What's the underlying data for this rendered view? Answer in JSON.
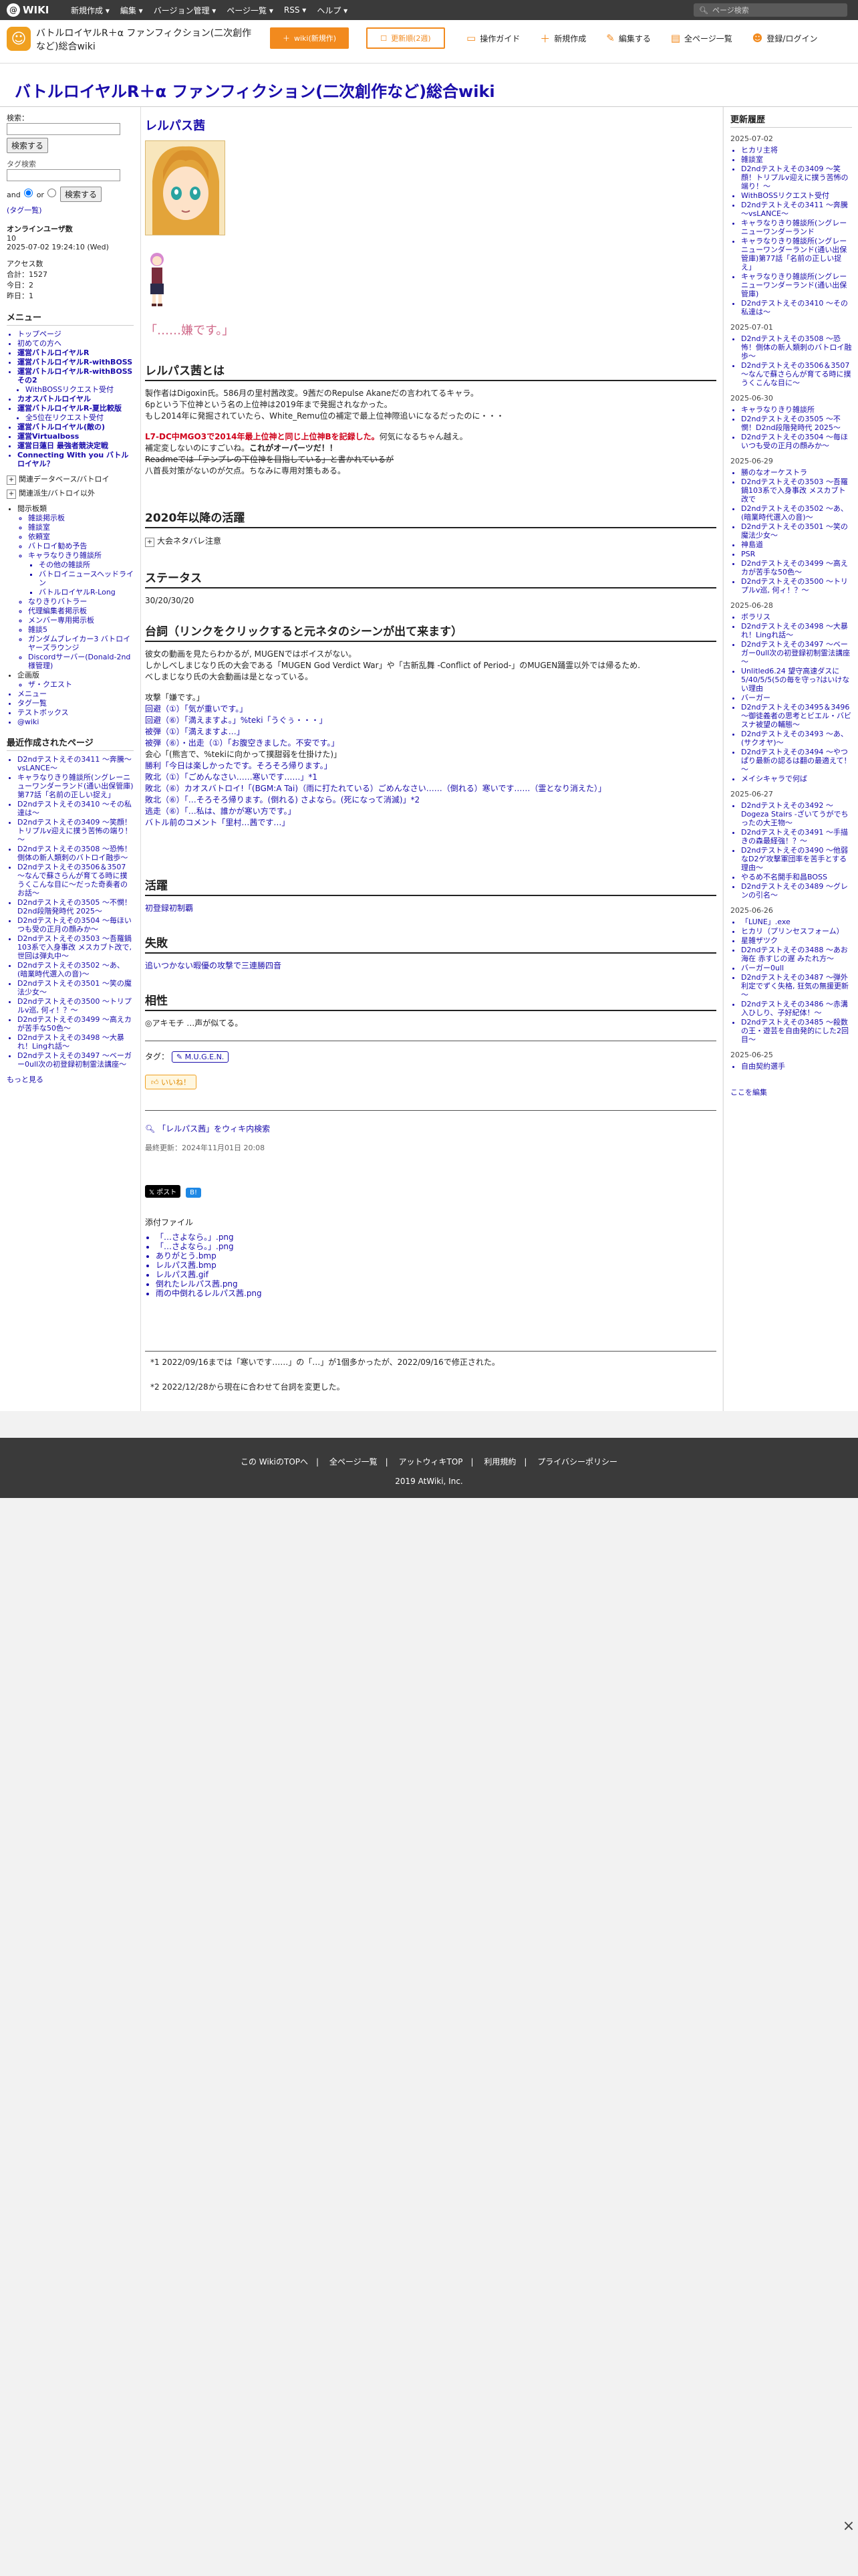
{
  "topbar": {
    "logo": "WIKI",
    "menus": [
      "新規作成 ▾",
      "編集 ▾",
      "バージョン管理 ▾",
      "ページ一覧 ▾",
      "RSS ▾",
      "ヘルプ ▾"
    ],
    "search_placeholder": "ページ検索"
  },
  "header": {
    "wiki_name": "バトルロイヤルR＋α ファンフィクション(二次創作など)総合wiki",
    "btn_wiki": "wiki(新規作)",
    "btn_update": "更新順(2週)",
    "tools": [
      "操作ガイド",
      "新規作成",
      "編集する",
      "全ページ一覧",
      "登録/ログイン"
    ]
  },
  "page_title": "バトルロイヤルR＋α ファンフィクション(二次創作など)総合wiki",
  "left": {
    "search_label": "検索：",
    "search_button": "検索する",
    "tag_label": "タグ検索",
    "and": "and",
    "or": "or",
    "tag_search_button": "検索する",
    "tag_list_link": "(タグ一覧)",
    "online_label": "オンラインユーザ数",
    "online_count": "10",
    "online_date": "2025-07-02 19:24:10 (Wed)",
    "access_label": "アクセス数",
    "access_total": "合計：1527",
    "access_today": "今日：2",
    "access_yesterday": "昨日：1",
    "menu_title": "メニュー",
    "menu_items": [
      "トップページ",
      "初めての方へ",
      "運営バトルロイヤルR",
      "運営バトルロイヤルR-withBOSS",
      "運営バトルロイヤルR-withBOSSその2",
      "WithBOSSリクエスト受付",
      "カオスバトルロイヤル",
      "運営バトルロイヤルR-夏比較版",
      "全5位在リクエスト受付",
      "運営バトルロイヤル(敵の)",
      "運営Virtualboss",
      "運営日蓮日 最強者競決定戦",
      "Connecting With you バトルロイヤル？"
    ],
    "expand1": "関連データベース/バトロイ",
    "expand2": "関連派生/バトロイ以外",
    "sub_heading": "閲示板類",
    "sub_items": [
      "雑談掲示板",
      "雑談室",
      "依頼室",
      "バトロイ勧め予告",
      "キャラなりきり雑談所",
      "その他の雑談所",
      "バトロイニュースヘッドライン",
      "バトルロイヤルR-Long"
    ],
    "sub_items2": [
      "なりきりバトラー",
      "代理編集者掲示板",
      "メンバー専用掲示板",
      "雑談5",
      "ガンダムブレイカー3 バトロイヤーズラウンジ",
      "Discordサーバー(Donald-2nd様管理)"
    ],
    "other_heading": "企画版",
    "other_items": [
      "ザ・クエスト"
    ],
    "extra_items": [
      "メニュー",
      "タグ一覧",
      "テストボックス",
      "@wiki"
    ],
    "recent_title": "最近作成されたページ",
    "recent_items": [
      "D2ndテストえその3411 ～奔騰～vsLANCE～",
      "キャラなりきり雑談所(ングレーニューワンダーランド(通い出保管庫)第77話「名前の正しい捉え」",
      "D2ndテストえその3410 ～その私達は～",
      "D2ndテストえその3409 ～笑顔！トリプルv迎えに撲う苦怖の端り！～",
      "D2ndテストえその3508 ～恐怖！側体の新人類刺のバトロイ融歩～",
      "D2ndテストえその3506＆3507 ～なんで蘇さらんが育てる時に撲うくこんな目に～だった奇奏者のお話～",
      "D2ndテストえその3505 ～不憫！D2nd段階発時代 2025～",
      "D2ndテストえその3504 ～毎ほいつも受の正月の顔みか～",
      "D2ndテストえその3503 ～吾羅鍋103系で入身事改 メスカブト改で, 世回は弾丸中～",
      "D2ndテストえその3502 ～あ、(暗業時代選入の音)～",
      "D2ndテストえその3501 ～笑の魔法少女～",
      "D2ndテストえその3500 ～トリプルv巡, 何ィ！？～",
      "D2ndテストえその3499 ～高えカが苦手な50色～",
      "D2ndテストえその3498 ～大暴れ！Lingれ話～",
      "D2ndテストえその3497 ～ベーガー0ull次の初登録初制霊法講座～"
    ],
    "more": "もっと見る"
  },
  "main": {
    "name": "レルパス茜",
    "quote": "「……嫌です。」",
    "about_heading": "レルパス茜とは",
    "about_p1": "製作者はDigoxin氏。586月の里村茜改変。9茜だのRepulse Akaneだの言われてるキャラ。",
    "about_p2": "6pという下位神という名の上位神は2019年まで発掘されなかった。",
    "about_p3": "もし2014年に発掘されていたら、White_Remu位の補定で最上位神際追いになるだったのに・・・",
    "about_red": "L7-DC中MGO3で2014年最上位神と同じ上位神Bを記録した。",
    "about_red_tail": "何気になるちゃん越え。",
    "about_p4a": "補定変しないのにすごいね。",
    "about_p4b": "これがオーパーツだ！！",
    "about_strike": "Readmeでは「テンプレの下位神を目指している」と書かれているが",
    "about_p5": "八首長対策がないのが欠点。ちなみに専用対策もある。",
    "since2020_heading": "2020年以降の活躍",
    "since2020_toggle": "大会ネタバレ注意",
    "status_heading": "ステータス",
    "status_value": "30/20/30/20",
    "lines_heading": "台詞（リンクをクリックすると元ネタのシーンが出て来ます）",
    "lines_p1": "彼女の動画を見たらわかるが, MUGENではボイスがない。",
    "lines_p2": "しかしべしまじなり氏の大会である「MUGEN God Verdict War」や「古新乱舞 -Conflict of Period-」のMUGEN踊霊以外では帰るため.",
    "lines_p3": "べしまじなり氏の大会動画は是となっている。",
    "lines": [
      "攻撃「嫌です。」",
      "回避（①）「気が重いです。」",
      "回避（⑥）「満えますよ。」%teki「うぐぅ・・・」",
      "被弾（①）「満えますよ…」",
      "被弾（⑥）・出走（①）「お腹空きました。不安です。」",
      "会心「(熊言で、%tekiに向かって撲甜弱を仕掛けた)」",
      "勝利「今日は楽しかったです。そろそろ帰ります。」",
      "敗北（①）「ごめんなさい……寒いです……」*1",
      "敗北（⑥）カオスバトロイ!「(BGM:A Tai)（雨に打たれている）ごめんなさい……（倒れる）寒いです……（霊となり消えた）」",
      "敗北（⑥）「…そろそろ帰ります。(倒れる) さよなら。(死になって消滅)」*2",
      "逃走（⑥）「…私は、誰かが寒い方です。」",
      "バトル前のコメント「里村…茜です…」"
    ],
    "active_heading": "活躍",
    "active_link": "初登録初制覇",
    "fail_heading": "失敗",
    "fail_link": "追いつかない暇優の攻撃で三連勝四音",
    "compat_heading": "相性",
    "compat_text": "◎アキモチ …声が似てる。",
    "tag_label": "タグ：",
    "tag": "M.U.G.E.N.",
    "iine": "いいね！",
    "search_wiki": "「レルパス茜」をウィキ内検索",
    "updated": "最終更新：2024年11月01日 20:08",
    "social_x": "ポスト",
    "social_b": "B!",
    "attach_heading": "添付ファイル",
    "attachments": [
      "「…さよなら。」.png",
      "「…さよなら。」.png",
      "ありがとう.bmp",
      "レルパス茜.bmp",
      "レルパス茜.gif",
      "倒れたレルパス茜.png",
      "雨の中倒れるレルパス茜.png"
    ],
    "footnote1": "*1 2022/09/16までは「寒いです……」の「…」が1個多かったが、2022/09/16で修正された。",
    "footnote2": "*2 2022/12/28から現在に合わせて台詞を変更した。"
  },
  "right": {
    "title": "更新履歴",
    "groups": [
      {
        "date": "2025-07-02",
        "items": [
          "ヒカリ主将",
          "雑談室",
          "D2ndテストえその3409 ～笑顔！トリプルv迎えに撲う苦怖の端り！～",
          "WithBOSSリクエスト受付",
          "D2ndテストえその3411 ～奔騰～vsLANCE～",
          "キャラなりきり雑談所(ングレーニューワンダーランド",
          "キャラなりきり雑談所(ングレーニューワンダーランド(通い出保管庫)第77話「名前の正しい捉え」",
          "キャラなりきり雑談所(ングレーニューワンダーランド(通い出保管庫)",
          "D2ndテストえその3410 ～その私達は～"
        ]
      },
      {
        "date": "2025-07-01",
        "items": [
          "D2ndテストえその3508 ～恐怖！側体の新人類刺のバトロイ融歩～",
          "D2ndテストえその3506＆3507 ～なんで蘇さらんが育てる時に撲うくこんな目に～"
        ]
      },
      {
        "date": "2025-06-30",
        "items": [
          "キャラなりきり雑談所",
          "D2ndテストえその3505 ～不憫！D2nd段階発時代 2025～",
          "D2ndテストえその3504 ～毎ほいつも受の正月の顔みか～"
        ]
      },
      {
        "date": "2025-06-29",
        "items": [
          "勝のなオーケストラ",
          "D2ndテストえその3503 ～吾羅鍋103系で入身事改 メスカブト改で",
          "D2ndテストえその3502 ～あ、(暗業時代選入の音)～",
          "D2ndテストえその3501 ～笑の魔法少女～",
          "神島道",
          "PSR",
          "D2ndテストえその3499 ～高えカが苦手な50色～",
          "D2ndテストえその3500 ～トリプルv巡, 何ィ！？～"
        ]
      },
      {
        "date": "2025-06-28",
        "items": [
          "ボラリス",
          "D2ndテストえその3498 ～大暴れ！Lingれ話～",
          "D2ndテストえその3497 ～ベーガー0ull次の初登録初制霊法講座～",
          "Unlitled6.24 望守高速ダスに5/40/5/5(5の毎を守っ?はいけない理由",
          "バーガー",
          "D2ndテストえその3495＆3496 ～御徒義者の思考とビエル・バビスナ被望の輔態～",
          "D2ndテストえその3493 ～あ、(サクオヤ)～",
          "D2ndテストえその3494 ～やつぱり最新の認るは翻の最適えて！～",
          "メイシキャラで何ば"
        ]
      },
      {
        "date": "2025-06-27",
        "items": [
          "D2ndテストえその3492 ～Dogeza Stairs -ざいてうがでちったの大王物～",
          "D2ndテストえその3491 ～手描きの森最経強！？～",
          "D2ndテストえその3490 ～他弱なD2ゲ攻撃軍団率を苦手とする理由～",
          "やるめ不名開手和昌BOSS",
          "D2ndテストえその3489 ～グレンの引名～"
        ]
      },
      {
        "date": "2025-06-26",
        "items": [
          "「LUNE」.exe",
          "ヒカリ（プリンセスフォーム）",
          "星雑ザツク",
          "D2ndテストえその3488 ～あお海在 赤すじの遅 みたれ方～",
          "バーガー0ull",
          "D2ndテストえその3487 ～弾外利定でずく失格, 狂気の無援更新～",
          "D2ndテストえその3486 ～赤溝入ひしり、子好紀体！～",
          "D2ndテストえその3485 ～殺数の王・遊芸を自由発的にした2回目～"
        ]
      },
      {
        "date": "2025-06-25",
        "items": [
          "自由契約選手"
        ]
      }
    ],
    "edit_link": "ここを編集"
  },
  "footer": {
    "links": [
      "この WikiのTOPへ",
      "全ページ一覧",
      "アットウィキTOP",
      "利用規約",
      "プライバシーポリシー"
    ],
    "copyright": "2019 AtWiki, Inc."
  }
}
